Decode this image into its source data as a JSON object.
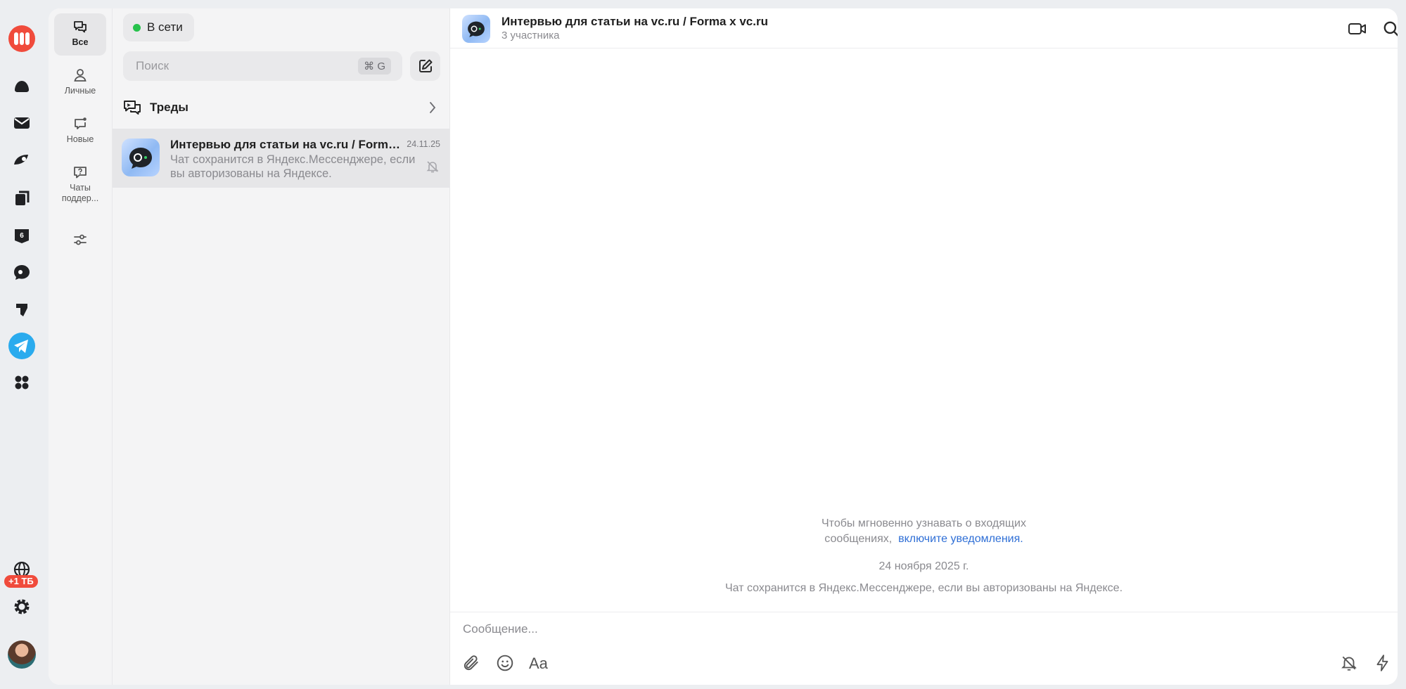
{
  "storage_badge": "+1 ТБ",
  "status": {
    "label": "В сети",
    "color": "#27c24c"
  },
  "folders": [
    {
      "label": "Все"
    },
    {
      "label": "Личные"
    },
    {
      "label": "Новые"
    },
    {
      "label": "Чаты поддер..."
    }
  ],
  "search": {
    "placeholder": "Поиск",
    "hotkey": "⌘ G"
  },
  "threads": {
    "label": "Треды"
  },
  "chat_list": [
    {
      "title": "Интервью для статьи на vc.ru / Forma x vc.ru",
      "date": "24.11.25",
      "preview": "Чат сохранится в Яндекс.Мессенджере, если вы авторизованы на Яндексе."
    }
  ],
  "conversation": {
    "title": "Интервью для статьи на vc.ru / Forma x vc.ru",
    "subtitle": "3 участника",
    "notify_text_1": "Чтобы мгновенно узнавать о входящих",
    "notify_text_2": "сообщениях,",
    "notify_link": "включите уведомления.",
    "date_separator": "24 ноября 2025 г.",
    "system_note": "Чат сохранится в Яндекс.Мессенджере, если вы авторизованы на Яндексе.",
    "composer_placeholder": "Сообщение..."
  },
  "colors": {
    "accent": "#2f6fd6",
    "brand": "#f04b3c",
    "telegram": "#2aabee"
  }
}
